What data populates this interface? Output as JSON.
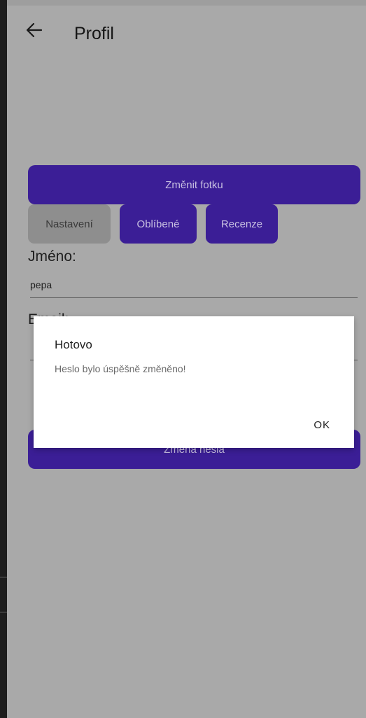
{
  "app_bar": {
    "title": "Profil",
    "back_icon": "arrow-left-icon"
  },
  "profile": {
    "change_photo_label": "Změnit fotku",
    "tabs": [
      {
        "label": "Nastavení",
        "selected": true
      },
      {
        "label": "Oblíbené",
        "selected": false
      },
      {
        "label": "Recenze",
        "selected": false
      }
    ],
    "name_label": "Jméno:",
    "name_value": "pepa",
    "email_label": "Email:",
    "change_password_label": "Změna hesla"
  },
  "dialog": {
    "title": "Hotovo",
    "message": "Heslo bylo úspěšně změněno!",
    "ok_label": "OK"
  },
  "colors": {
    "primary": "#3b1e96",
    "scrim_background": "#a9a9a9",
    "dialog_background": "#ffffff"
  }
}
